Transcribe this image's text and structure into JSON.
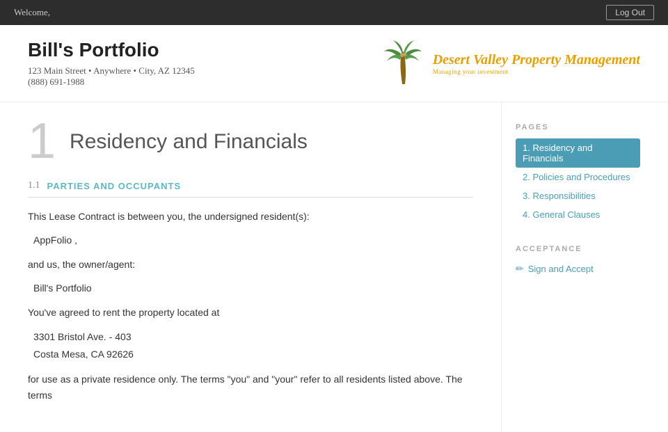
{
  "topnav": {
    "welcome_text": "Welcome,",
    "logout_label": "Log Out"
  },
  "header": {
    "portfolio_name": "Bill's Portfolio",
    "address_line1": "123 Main Street • Anywhere • City, AZ 12345",
    "phone": "(888) 691-1988",
    "logo_text": "Desert Valley Property Management",
    "logo_sub": "Managing your investment"
  },
  "pages_section": {
    "title": "PAGES",
    "items": [
      {
        "number": "1.",
        "label": "Residency and Financials",
        "active": true
      },
      {
        "number": "2.",
        "label": "Policies and Procedures",
        "active": false
      },
      {
        "number": "3.",
        "label": "Responsibilities",
        "active": false
      },
      {
        "number": "4.",
        "label": "General Clauses",
        "active": false
      }
    ]
  },
  "acceptance_section": {
    "title": "ACCEPTANCE",
    "sign_accept_label": "Sign and Accept"
  },
  "content": {
    "section_number": "1",
    "section_title": "Residency and Financials",
    "subsection_number": "1.1",
    "subsection_title": "PARTIES AND OCCUPANTS",
    "paragraph1": "This Lease Contract is between you, the undersigned resident(s):",
    "resident_name": "AppFolio ,",
    "owner_intro": "and us, the owner/agent:",
    "owner_name": "Bill's Portfolio",
    "property_intro": "You've agreed to rent the property located at",
    "address_line1": "3301 Bristol Ave. - 403",
    "address_line2": "Costa Mesa, CA 92626",
    "paragraph_end": "for use as a private residence only. The terms \"you\" and \"your\" refer to all residents listed above. The terms"
  }
}
